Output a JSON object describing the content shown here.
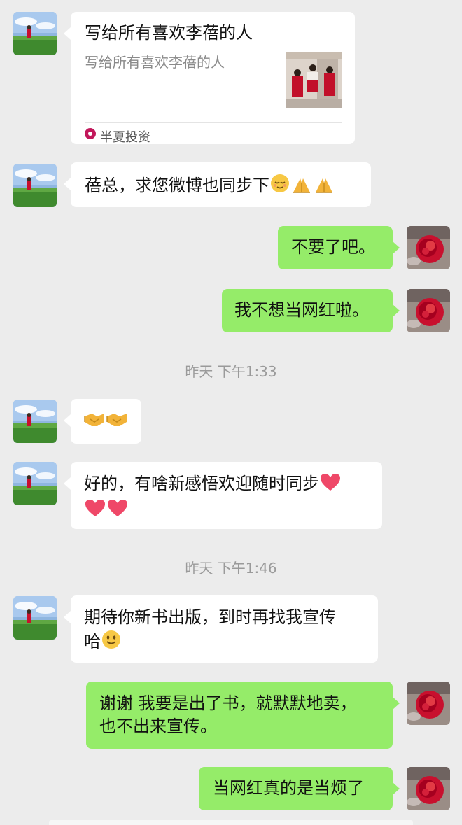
{
  "messages": {
    "link_card": {
      "title": "写给所有喜欢李蓓的人",
      "description": "写给所有喜欢李蓓的人",
      "source": "半夏投资"
    },
    "m1": "蓓总，求您微博也同步下",
    "m2": "不要了吧。",
    "m3": "我不想当网红啦。",
    "time1": "昨天 下午1:33",
    "m5_line1": "好的，有啥新感悟欢迎随时同步",
    "time2": "昨天 下午1:46",
    "m6_line1": "期待你新书出版，到时再找我宣传",
    "m6_line2": "哈",
    "m7_line1": "谢谢 我要是出了书，就默默地卖，",
    "m7_line2": "也不出来宣传。",
    "m8": "当网红真的是当烦了"
  },
  "icons": {
    "left_avatar": "landscape-girl-avatar",
    "right_avatar": "red-rose-avatar",
    "emoji_sleepy": "relieved-face-emoji",
    "emoji_pray": "folded-hands-emoji",
    "emoji_handshake": "handshake-emoji",
    "emoji_heart": "red-heart-emoji",
    "emoji_smile": "smiling-face-emoji"
  },
  "colors": {
    "background": "#ececec",
    "sent_bubble": "#95ec69",
    "received_bubble": "#ffffff",
    "timestamp": "#9a9a9a"
  }
}
